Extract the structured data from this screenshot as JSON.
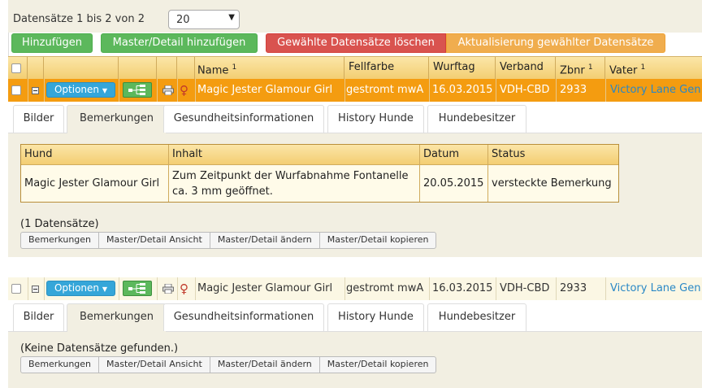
{
  "toolbar": {
    "count_label": "Datensätze 1 bis 2 von 2",
    "page_size": "20",
    "add_label": "Hinzufügen",
    "add_master_detail_label": "Master/Detail hinzufügen",
    "delete_selected_label": "Gewählte Datensätze löschen",
    "update_selected_label": "Aktualisierung gewählter Datensätze"
  },
  "columns": {
    "name": "Name",
    "name_sup": "1",
    "fellfarbe": "Fellfarbe",
    "wurftag": "Wurftag",
    "verband": "Verband",
    "zbnr": "Zbnr",
    "zbnr_sup": "1",
    "vater": "Vater",
    "vater_sup": "1"
  },
  "options_label": "Optionen",
  "rows": [
    {
      "name": "Magic Jester Glamour Girl",
      "fellfarbe": "gestromt mwA",
      "wurftag": "16.03.2015",
      "verband": "VDH-CBD",
      "zbnr": "2933",
      "vater": "Victory Lane Gen",
      "sex_symbol": "♀"
    },
    {
      "name": "Magic Jester Glamour Girl",
      "fellfarbe": "gestromt mwA",
      "wurftag": "16.03.2015",
      "verband": "VDH-CBD",
      "zbnr": "2933",
      "vater": "Victory Lane Gen",
      "sex_symbol": "♀"
    }
  ],
  "tabs": [
    "Bilder",
    "Bemerkungen",
    "Gesundheitsinformationen",
    "History Hunde",
    "Hundebesitzer"
  ],
  "detail1": {
    "headers": [
      "Hund",
      "Inhalt",
      "Datum",
      "Status"
    ],
    "row": {
      "hund": "Magic Jester Glamour Girl",
      "inhalt_line1": "Zum Zeitpunkt der Wurfabnahme Fontanelle",
      "inhalt_line2": "ca. 3 mm geöffnet.",
      "datum": "20.05.2015",
      "status": "versteckte Bemerkung"
    },
    "record_count": "(1 Datensätze)"
  },
  "detail2": {
    "record_count": "(Keine Datensätze gefunden.)"
  },
  "detail_buttons": [
    "Bemerkungen",
    "Master/Detail Ansicht",
    "Master/Detail ändern",
    "Master/Detail kopieren"
  ],
  "colors": {
    "selected_row": "#f49c10",
    "header_gold": "#f3ce72",
    "green": "#5cb85c",
    "red": "#d9534f",
    "orange": "#f0ad4e",
    "blue": "#35a6d9",
    "link": "#2a88c6"
  }
}
